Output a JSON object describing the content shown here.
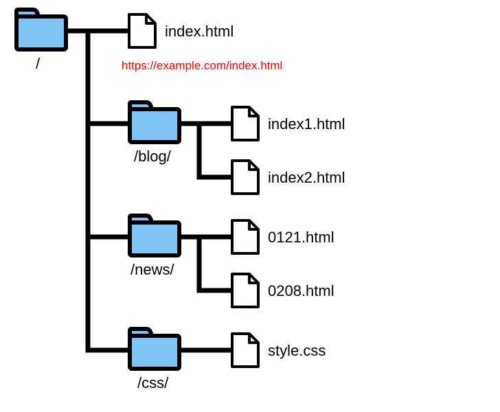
{
  "root": {
    "label": "/"
  },
  "index": {
    "label": "index.html"
  },
  "url_note": "https://example.com/index.html",
  "blog": {
    "label": "/blog/",
    "files": [
      "index1.html",
      "index2.html"
    ]
  },
  "news": {
    "label": "/news/",
    "files": [
      "0121.html",
      "0208.html"
    ]
  },
  "css": {
    "label": "/css/",
    "files": [
      "style.css"
    ]
  }
}
